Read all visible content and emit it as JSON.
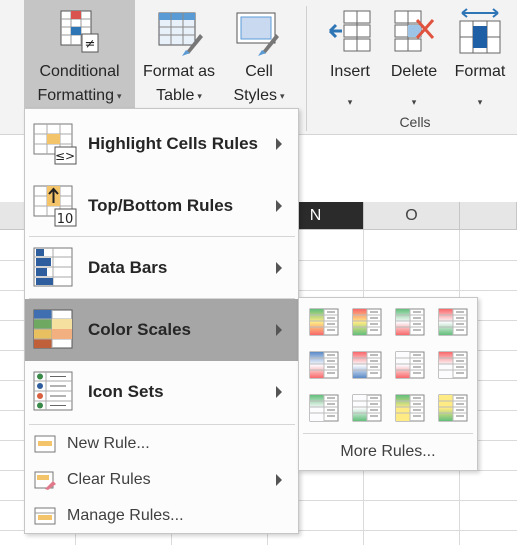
{
  "ribbon": {
    "conditional_formatting": {
      "line1": "Conditional",
      "line2": "Formatting",
      "icon": "conditional-formatting-icon"
    },
    "format_as_table": {
      "line1": "Format as",
      "line2": "Table",
      "icon": "format-as-table-icon"
    },
    "cell_styles": {
      "line1": "Cell",
      "line2": "Styles",
      "icon": "cell-styles-icon"
    },
    "insert": {
      "label": "Insert",
      "icon": "insert-cells-icon"
    },
    "delete": {
      "label": "Delete",
      "icon": "delete-cells-icon"
    },
    "format": {
      "label": "Format",
      "icon": "format-cells-icon"
    },
    "cells_group_label": "Cells",
    "caret": "▾"
  },
  "sheet": {
    "columns": [
      "N",
      "O"
    ],
    "selected_column": "N"
  },
  "menu": {
    "items": [
      {
        "label": "Highlight Cells Rules",
        "icon": "highlight-cells-rules-icon",
        "submenu": true
      },
      {
        "label": "Top/Bottom Rules",
        "icon": "top-bottom-rules-icon",
        "submenu": true
      },
      {
        "label": "Data Bars",
        "icon": "data-bars-icon",
        "submenu": true
      },
      {
        "label": "Color Scales",
        "icon": "color-scales-icon",
        "submenu": true,
        "active": true
      },
      {
        "label": "Icon Sets",
        "icon": "icon-sets-icon",
        "submenu": true
      }
    ],
    "small_items": [
      {
        "label": "New Rule...",
        "icon": "new-rule-icon",
        "submenu": false
      },
      {
        "label": "Clear Rules",
        "icon": "clear-rules-icon",
        "submenu": true
      },
      {
        "label": "Manage Rules...",
        "icon": "manage-rules-icon",
        "submenu": false
      }
    ]
  },
  "color_scales_submenu": {
    "swatch_icon": "color-scale-swatch-icon",
    "swatches": [
      [
        "#63be7b",
        "#ffeb84",
        "#f8696b"
      ],
      [
        "#f8696b",
        "#ffeb84",
        "#63be7b"
      ],
      [
        "#63be7b",
        "#fcfcff",
        "#f8696b"
      ],
      [
        "#f8696b",
        "#fcfcff",
        "#63be7b"
      ],
      [
        "#5a8ac6",
        "#fcfcff",
        "#f8696b"
      ],
      [
        "#f8696b",
        "#fcfcff",
        "#5a8ac6"
      ],
      [
        "#fcfcff",
        "#fcfcff",
        "#f8696b"
      ],
      [
        "#f8696b",
        "#fcfcff",
        "#fcfcff"
      ],
      [
        "#63be7b",
        "#fcfcff",
        "#fcfcff"
      ],
      [
        "#fcfcff",
        "#fcfcff",
        "#63be7b"
      ],
      [
        "#63be7b",
        "#ffeb84",
        "#ffeb84"
      ],
      [
        "#ffeb84",
        "#ffeb84",
        "#63be7b"
      ]
    ],
    "more_rules": "More Rules..."
  }
}
